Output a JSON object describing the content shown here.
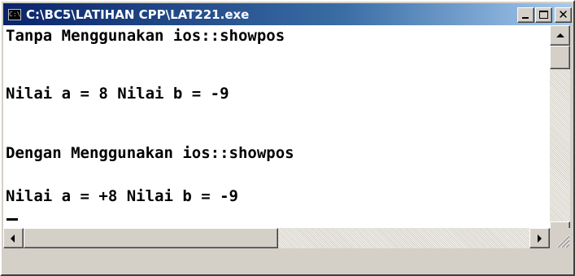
{
  "window": {
    "title": "C:\\BC5\\LATIHAN CPP\\LAT221.exe",
    "icon": "console-window-icon",
    "icon_text": "C:\\",
    "title_gradient": [
      "#0a246a",
      "#a6caf0"
    ]
  },
  "caption_buttons": {
    "minimize": "minimize-icon",
    "maximize": "maximize-icon",
    "close": "close-icon",
    "close_glyph": "✕"
  },
  "console": {
    "background": "#ffffff",
    "text_color": "#000000",
    "lines": [
      "Tanpa Menggunakan ios::showpos",
      "Nilai a = 8 Nilai b = -9",
      "",
      "Dengan Menggunakan ios::showpos",
      "Nilai a = +8 Nilai b = -9"
    ],
    "cursor": "_"
  },
  "scrollbars": {
    "vertical_position": 0,
    "horizontal_position": 0
  }
}
